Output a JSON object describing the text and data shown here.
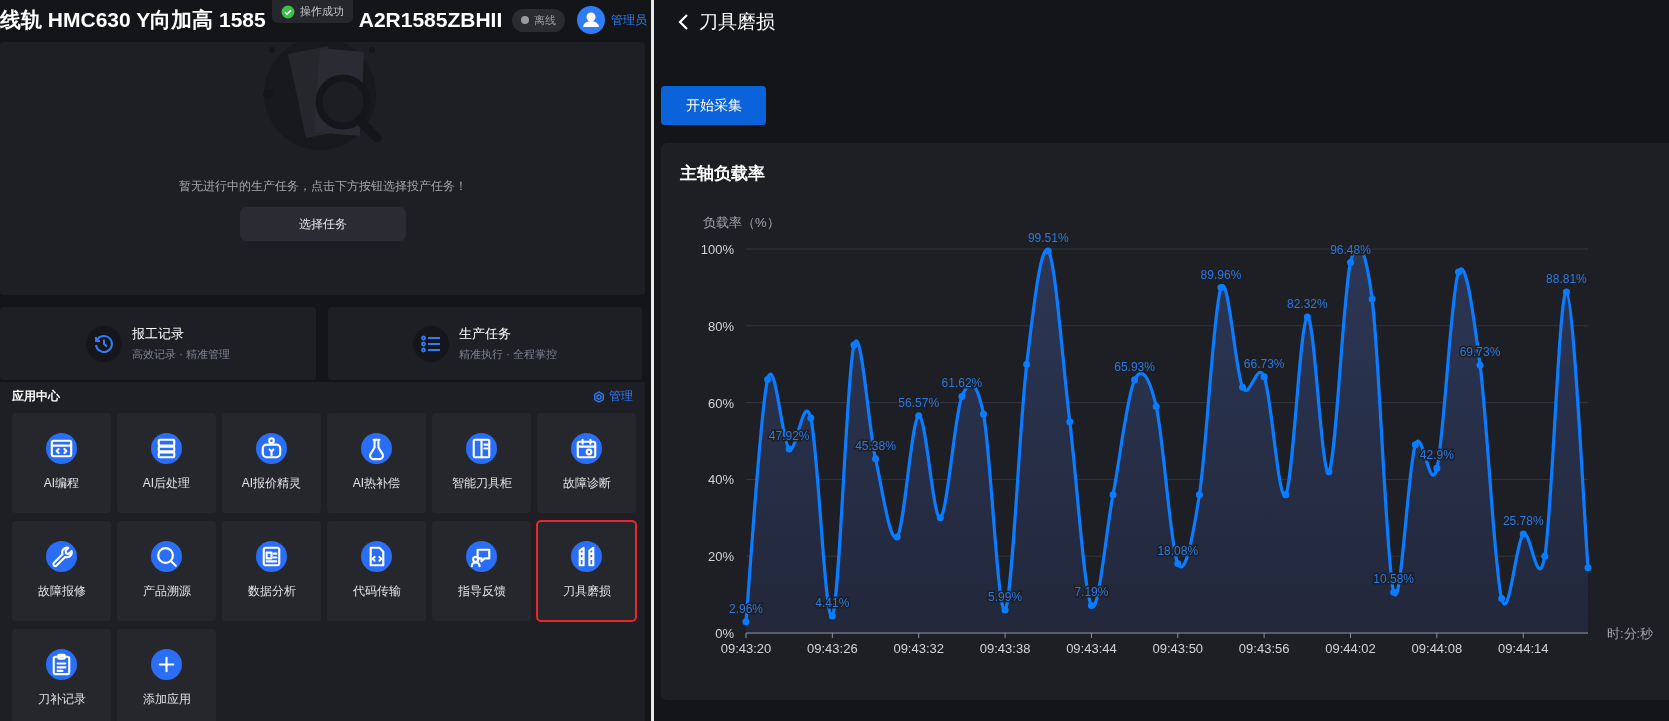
{
  "header": {
    "title": "线轨 HMC630 Y向加高 1585",
    "code": "A2R1585ZBHII",
    "status": {
      "label": "离线",
      "online": false
    },
    "user": "管理员"
  },
  "toast": {
    "message": "操作成功",
    "kind": "success"
  },
  "empty_task": {
    "message": "暂无进行中的生产任务，点击下方按钮选择投产任务！",
    "button": "选择任务"
  },
  "shortcuts": [
    {
      "title": "报工记录",
      "subtitle": "高效记录 · 精准管理"
    },
    {
      "title": "生产任务",
      "subtitle": "精准执行 · 全程掌控"
    }
  ],
  "app_center": {
    "title": "应用中心",
    "manage": "管理",
    "apps": [
      {
        "label": "AI编程",
        "highlighted": false
      },
      {
        "label": "AI后处理",
        "highlighted": false
      },
      {
        "label": "AI报价精灵",
        "highlighted": false
      },
      {
        "label": "AI热补偿",
        "highlighted": false
      },
      {
        "label": "智能刀具柜",
        "highlighted": false
      },
      {
        "label": "故障诊断",
        "highlighted": false
      },
      {
        "label": "故障报修",
        "highlighted": false
      },
      {
        "label": "产品溯源",
        "highlighted": false
      },
      {
        "label": "数据分析",
        "highlighted": false
      },
      {
        "label": "代码传输",
        "highlighted": false
      },
      {
        "label": "指导反馈",
        "highlighted": false
      },
      {
        "label": "刀具磨损",
        "highlighted": true
      },
      {
        "label": "刀补记录",
        "highlighted": false
      },
      {
        "label": "添加应用",
        "highlighted": false
      }
    ]
  },
  "page": {
    "title": "刀具磨损",
    "start_button": "开始采集"
  },
  "chart_card": {
    "title": "主轴负载率",
    "chart_data": {
      "type": "area",
      "ylabel": "负载率（%）",
      "xlabel": "时:分:秒",
      "categories": [
        "09:43:20",
        null,
        null,
        null,
        "09:43:26",
        null,
        null,
        null,
        "09:43:32",
        null,
        null,
        null,
        "09:43:38",
        null,
        null,
        null,
        "09:43:44",
        null,
        null,
        null,
        "09:43:50",
        null,
        null,
        null,
        "09:43:56",
        null,
        null,
        null,
        "09:44:02",
        null,
        null,
        null,
        "09:44:08",
        null,
        null,
        null,
        "09:44:14",
        null,
        null,
        null
      ],
      "ylim": [
        0,
        100
      ],
      "grid": true,
      "yticks": [
        {
          "value": 0,
          "label": "0%"
        },
        {
          "value": 20,
          "label": "20%"
        },
        {
          "value": 40,
          "label": "40%"
        },
        {
          "value": 60,
          "label": "60%"
        },
        {
          "value": 80,
          "label": "80%"
        },
        {
          "value": 100,
          "label": "100%"
        }
      ],
      "series": [
        {
          "color": "#0a7cff",
          "values": [
            2.96,
            66,
            47.92,
            56,
            4.41,
            75,
            45.38,
            25,
            56.57,
            30,
            61.62,
            57,
            5.99,
            70,
            99.51,
            55,
            7.19,
            36,
            65.93,
            59,
            18.08,
            36,
            89.96,
            64,
            66.73,
            36,
            82.32,
            42,
            96.48,
            87,
            10.58,
            49,
            42.9,
            94,
            69.73,
            9,
            25.78,
            20,
            88.81,
            17
          ]
        }
      ],
      "value_labels": [
        "2.96%",
        null,
        "47.92%",
        null,
        "4.41%",
        null,
        "45.38%",
        null,
        "56.57%",
        null,
        "61.62%",
        null,
        "5.99%",
        null,
        "99.51%",
        null,
        "7.19%",
        null,
        "65.93%",
        null,
        "18.08%",
        null,
        "89.96%",
        null,
        "66.73%",
        null,
        "82.32%",
        null,
        "96.48%",
        null,
        "10.58%",
        null,
        "42.9%",
        null,
        "69.73%",
        null,
        "25.78%",
        null,
        "88.81%",
        null
      ]
    }
  }
}
